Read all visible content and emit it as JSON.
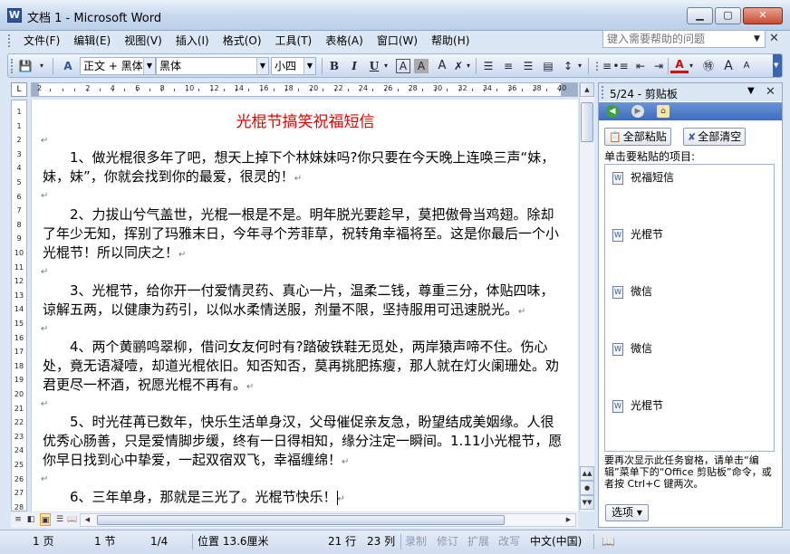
{
  "window": {
    "title": "文档 1 - Microsoft Word",
    "app_icon": "W",
    "minimize_icon": "minimize-icon",
    "maximize_icon": "maximize-icon",
    "close_icon": "close-icon"
  },
  "menu": {
    "items": [
      "文件(F)",
      "编辑(E)",
      "视图(V)",
      "插入(I)",
      "格式(O)",
      "工具(T)",
      "表格(A)",
      "窗口(W)",
      "帮助(H)"
    ],
    "help_placeholder": "键入需要帮助的问题"
  },
  "toolbar": {
    "style": "正文 + 黑体",
    "font": "黑体",
    "size": "小四",
    "bold": "B",
    "italic": "I",
    "underline": "U",
    "font_color": "#e00000",
    "highlight_color": "#ffff00"
  },
  "ruler": {
    "corner": "L",
    "numbers": [
      "2",
      "2",
      "4",
      "6",
      "8",
      "10",
      "12",
      "14",
      "16",
      "18",
      "20",
      "22",
      "24",
      "26",
      "28",
      "30",
      "32",
      "34",
      "36",
      "38",
      "40",
      "42"
    ],
    "vnumbers": [
      "1",
      "1",
      "2",
      "3",
      "4",
      "5",
      "6",
      "7",
      "8",
      "9",
      "10",
      "11",
      "12",
      "13",
      "14",
      "15",
      "16",
      "17",
      "18",
      "19",
      "20",
      "21",
      "22",
      "23",
      "24",
      "25",
      "26",
      "27",
      "28"
    ]
  },
  "document": {
    "title": "光棍节搞笑祝福短信",
    "title_color": "#e00000",
    "paragraph_mark": "↵",
    "paragraphs": [
      "1、做光棍很多年了吧，想天上掉下个林妹妹吗?你只要在今天晚上连唤三声“妹，妹，妹”，你就会找到你的最爱，很灵的！",
      "2、力拔山兮气盖世，光棍一根是不是。明年脱光要趁早，莫把傲骨当鸡翅。除却了年少无知，挥别了玛雅末日，今年寻个芳菲草，祝转角幸福将至。这是你最后一个小光棍节！所以同庆之！",
      "3、光棍节，给你开一付爱情灵药、真心一片，温柔二钱，尊重三分，体贴四味，谅解五两，以健康为药引，以似水柔情送服，剂量不限，坚持服用可迅速脱光。",
      "4、两个黄鹂鸣翠柳，借问女友何时有?踏破铁鞋无觅处，两岸猿声啼不住。伤心处，竟无语凝噎，却道光棍依旧。知否知否，莫再挑肥拣瘦，那人就在灯火阑珊处。劝君更尽一杯酒，祝愿光棍不再有。",
      "5、时光荏苒已数年，快乐生活单身汉，父母催促亲友急，盼望结成美姻缘。人很优秀心肠善，只是爱情脚步缓，终有一日得相知，缘分注定一瞬间。1.11小光棍节，愿你早日找到心中挚爱，一起双宿双飞，幸福缠绵！",
      "6、三年单身，那就是三光了。光棍节快乐！"
    ]
  },
  "taskpane": {
    "title": "5/24 - 剪贴板",
    "paste_all": "全部粘贴",
    "clear_all": "全部清空",
    "label": "单击要粘贴的项目:",
    "items": [
      "祝福短信",
      "光棍节",
      "微信",
      "微信",
      "光棍节"
    ],
    "note": "要再次显示此任务窗格，请单击“编辑”菜单下的“Office 剪贴板”命令，或者按 Ctrl+C 键两次。",
    "options": "选项 ▾"
  },
  "status": {
    "page": "1 页",
    "section": "1 节",
    "page_of": "1/4",
    "position": "位置 13.6厘米",
    "line": "21 行",
    "column": "23 列",
    "rec": "录制",
    "trk": "修订",
    "ext": "扩展",
    "ovr": "改写",
    "language": "中文(中国)"
  }
}
